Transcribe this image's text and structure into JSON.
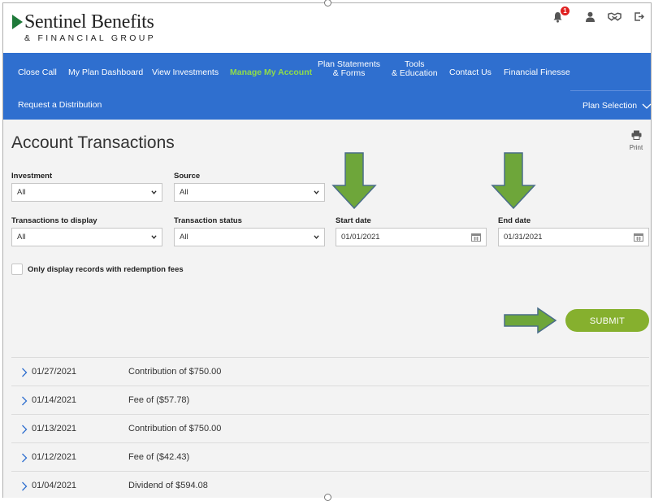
{
  "brand": {
    "name": "Sentinel Benefits",
    "tagline": "& FINANCIAL GROUP"
  },
  "header_icons": {
    "notifications": {
      "icon": "bell-icon",
      "count": "1"
    },
    "profile": {
      "icon": "user-icon"
    },
    "handshake": {
      "icon": "handshake-icon"
    },
    "logout": {
      "icon": "logout-icon"
    }
  },
  "nav": {
    "items": [
      {
        "label": "Close Call"
      },
      {
        "label": "My Plan Dashboard"
      },
      {
        "label": "View Investments"
      },
      {
        "label": "Manage My Account",
        "active": true
      },
      {
        "label_line1": "Plan Statements",
        "label_line2": "& Forms"
      },
      {
        "label_line1": "Tools",
        "label_line2": "& Education"
      },
      {
        "label": "Contact Us"
      },
      {
        "label": "Financial Finesse"
      }
    ],
    "row2": [
      {
        "label": "Request a Distribution"
      }
    ],
    "plan_selection": "Plan Selection"
  },
  "page": {
    "title": "Account Transactions",
    "print_label": "Print"
  },
  "filters": {
    "investment": {
      "label": "Investment",
      "value": "All"
    },
    "source": {
      "label": "Source",
      "value": "All"
    },
    "transactions_to_display": {
      "label": "Transactions to display",
      "value": "All"
    },
    "transaction_status": {
      "label": "Transaction status",
      "value": "All"
    },
    "start_date": {
      "label": "Start date",
      "value": "01/01/2021"
    },
    "end_date": {
      "label": "End date",
      "value": "01/31/2021"
    },
    "redemption_fees_label": "Only display records with redemption fees",
    "redemption_fees_checked": false
  },
  "submit_label": "SUBMIT",
  "colors": {
    "nav_bg": "#2f6fcf",
    "nav_active": "#8fdc4b",
    "submit": "#86b02e",
    "annotation_arrow": "#6ea63a",
    "badge": "#e02020"
  },
  "transactions": [
    {
      "date": "01/27/2021",
      "description": "Contribution of $750.00"
    },
    {
      "date": "01/14/2021",
      "description": "Fee of ($57.78)"
    },
    {
      "date": "01/13/2021",
      "description": "Contribution of $750.00"
    },
    {
      "date": "01/12/2021",
      "description": "Fee of ($42.43)"
    },
    {
      "date": "01/04/2021",
      "description": "Dividend of $594.08"
    }
  ]
}
